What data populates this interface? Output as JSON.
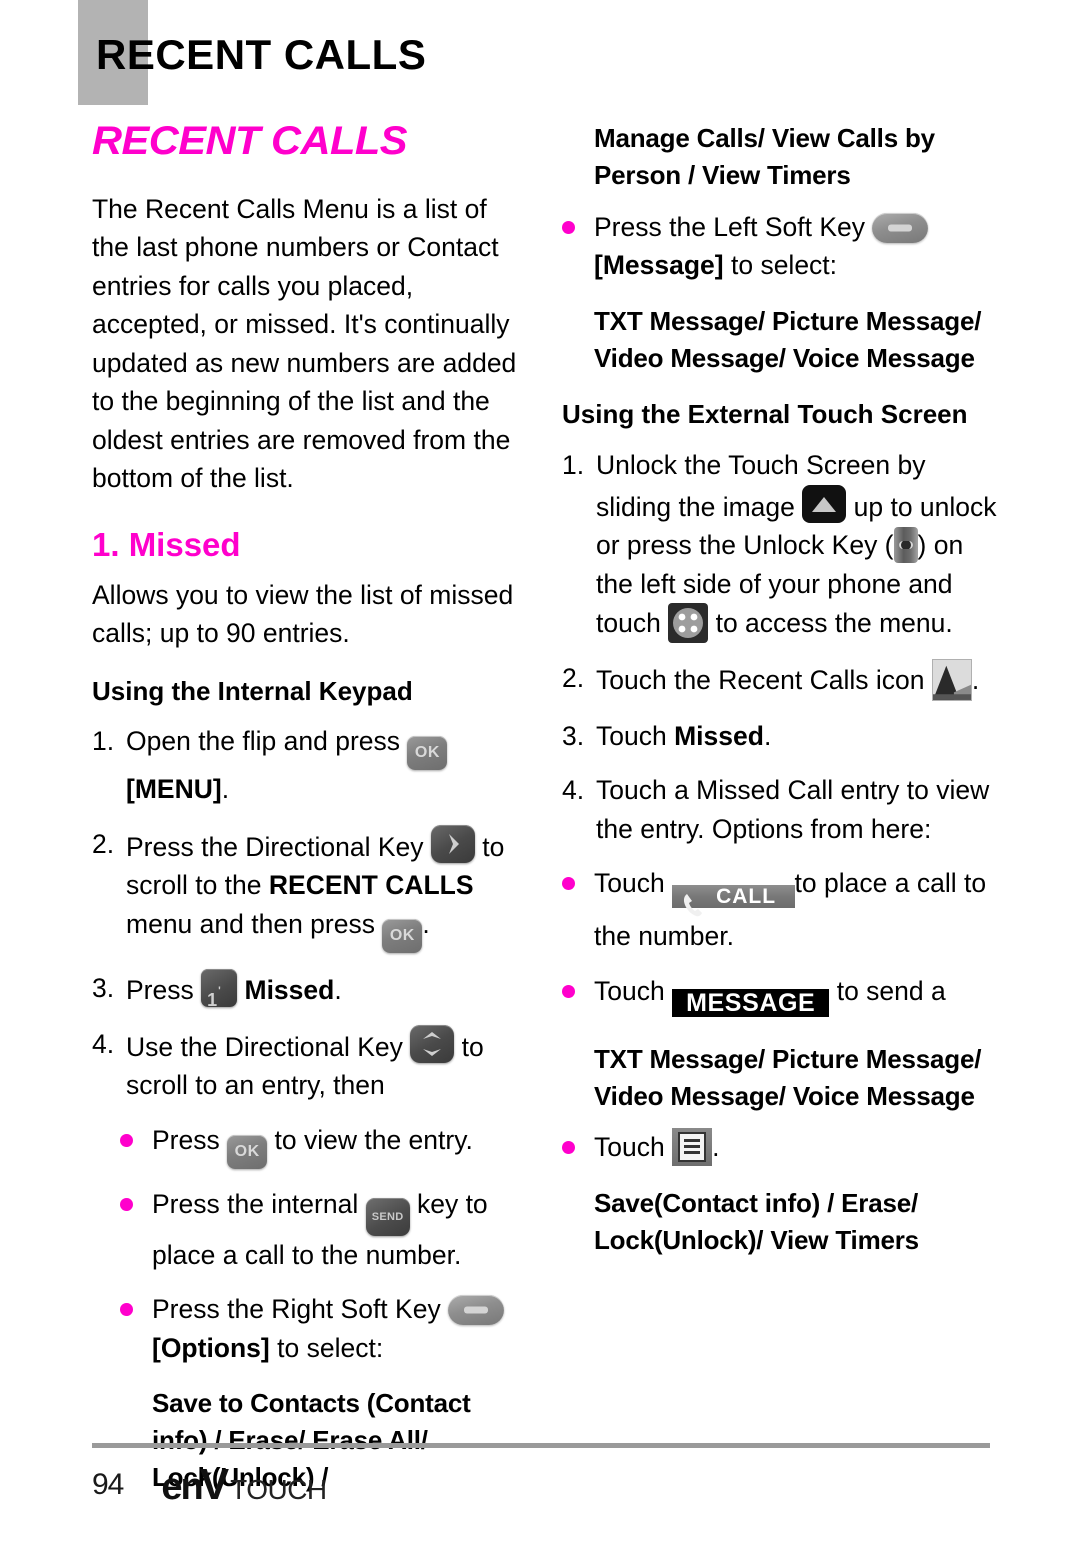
{
  "header": {
    "running_title": "RECENT CALLS"
  },
  "left_column": {
    "chapter_title": "RECENT CALLS",
    "intro_paragraph": "The Recent Calls Menu is a list of the last phone numbers or Contact entries for calls you placed, accepted, or missed. It's continually updated as new numbers are added to the beginning of the list and the oldest entries are removed from the bottom of the list.",
    "section_heading": "1. Missed",
    "section_body": "Allows you to view the list of missed calls; up to 90 entries.",
    "subhead_keypad": "Using the Internal Keypad",
    "steps": [
      {
        "marker": "1.",
        "text_before": "Open the flip and press",
        "icon": "ok-key-icon",
        "text_after_bold": "[MENU]",
        "text_after": "."
      },
      {
        "marker": "2.",
        "text_before": "Press the Directional Key",
        "icon": "directional-right-key-icon",
        "text_mid": "to scroll to the",
        "bold_mid": "RECENT CALLS",
        "text_mid2": "menu and then press",
        "icon2": "ok-key-icon",
        "text_after": "."
      },
      {
        "marker": "3.",
        "text_before": "Press",
        "icon": "number-one-key-icon",
        "bold_after": "Missed",
        "text_after": "."
      },
      {
        "marker": "4.",
        "text_before": "Use the Directional Key",
        "icon": "directional-updown-key-icon",
        "text_after": "to scroll to an entry, then"
      }
    ],
    "bullets": [
      {
        "text_before": "Press",
        "icon": "ok-key-icon",
        "text_after": "to view the entry."
      },
      {
        "text_before": "Press the internal",
        "icon": "send-key-icon",
        "text_after": "key to place a call to the number."
      },
      {
        "text_before": "Press the Right Soft Key",
        "icon": "soft-key-icon",
        "bold_after": "[Options]",
        "text_after": "to select:"
      }
    ],
    "options_list": "Save to Contacts (Contact info) / Erase/ Erase All/ Lock(Unlock) /"
  },
  "right_column": {
    "options_continued": "Manage Calls/ View Calls by Person / View Timers",
    "bullet_softkey": {
      "text_before": "Press the Left Soft Key",
      "icon": "soft-key-icon",
      "bold_after": "[Message]",
      "text_after": "to select:"
    },
    "message_types": "TXT Message/ Picture Message/ Video Message/ Voice Message",
    "subhead_touch": "Using the External Touch Screen",
    "steps": [
      {
        "marker": "1.",
        "p1": "Unlock the Touch Screen by sliding the image",
        "icon1": "slide-up-unlock-icon",
        "p2": "up to unlock or press the Unlock Key (",
        "icon2": "unlock-key-icon",
        "p3": ") on the left side of your phone and touch",
        "icon3": "menu-grid-icon",
        "p4": "to access the menu."
      },
      {
        "marker": "2.",
        "p1": "Touch the Recent Calls icon",
        "icon1": "recent-calls-icon",
        "p2": "."
      },
      {
        "marker": "3.",
        "p1": "Touch",
        "bold": "Missed",
        "p2": "."
      },
      {
        "marker": "4.",
        "p1": "Touch a Missed Call entry to view the entry. Options from here:"
      }
    ],
    "bullets": [
      {
        "text_before": "Touch",
        "button_label": "CALL",
        "icon": "phone-handset-icon",
        "text_after": "to place a call to the number."
      },
      {
        "text_before": "Touch",
        "button_label": "MESSAGE",
        "text_after": "to send a"
      },
      {
        "text_before": "Touch",
        "icon": "list-options-icon",
        "text_after": "."
      }
    ],
    "message_types_2": "TXT Message/ Picture Message/ Video Message/ Voice Message",
    "options_list_2": "Save(Contact info) / Erase/ Lock(Unlock)/ View Timers"
  },
  "footer": {
    "page_number": "94",
    "logo_en": "en",
    "logo_v": "V",
    "logo_touch": "TOUCH"
  },
  "colors": {
    "accent_magenta": "#ff00cc",
    "header_tab_gray": "#b3b3b3",
    "rule_gray": "#9a9a9a"
  }
}
